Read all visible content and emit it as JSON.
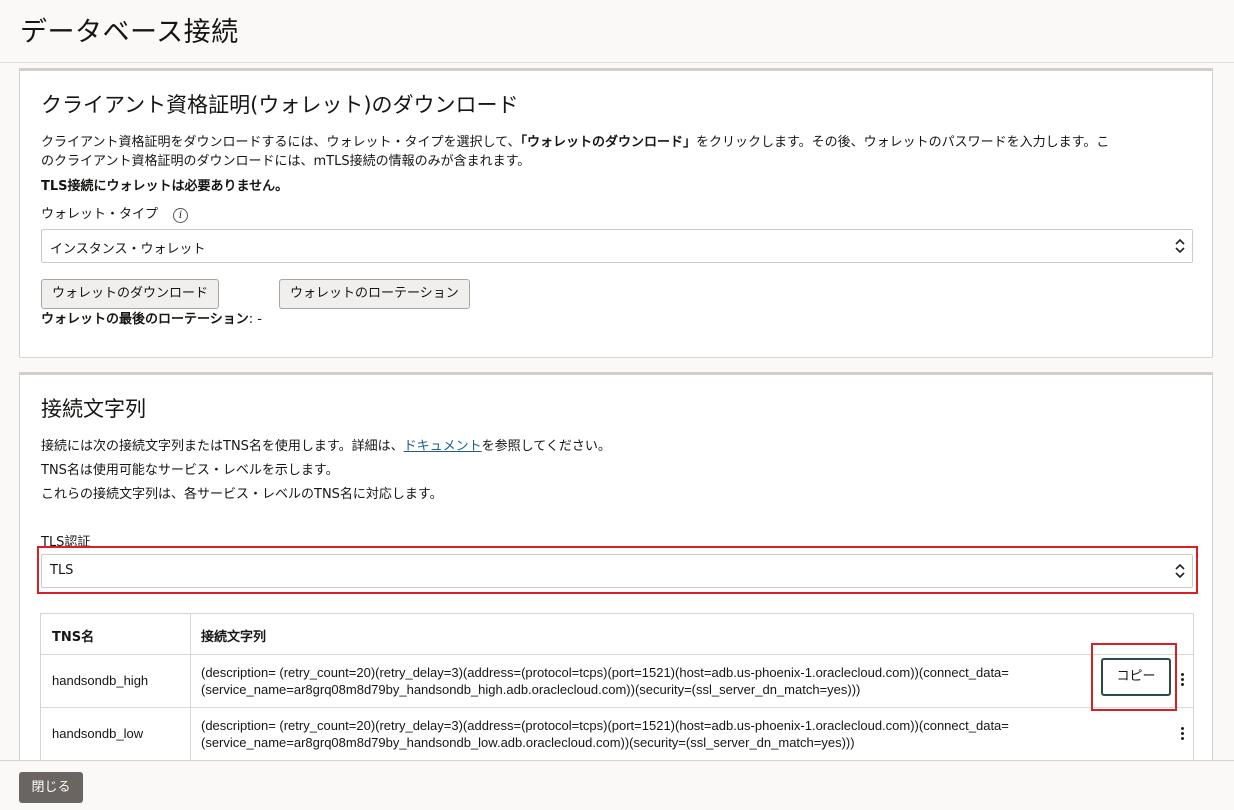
{
  "page_title": "データベース接続",
  "wallet_section": {
    "title": "クライアント資格証明(ウォレット)のダウンロード",
    "desc_part1": "クライアント資格証明をダウンロードするには、ウォレット・タイプを選択して、",
    "desc_bold": "「ウォレットのダウンロード」",
    "desc_part2": "をクリックします。その後、ウォレットのパスワードを入力します。こ",
    "desc_line2": "のクライアント資格証明のダウンロードには、mTLS接続の情報のみが含まれます。",
    "tls_note": "TLS接続にウォレットは必要ありません。",
    "wallet_type_label": "ウォレット・タイプ",
    "wallet_type_value": "インスタンス・ウォレット",
    "download_button": "ウォレットのダウンロード",
    "rotate_button": "ウォレットのローテーション",
    "last_rotation_label": "ウォレットの最後のローテーション",
    "last_rotation_value": ": -"
  },
  "conn_section": {
    "title": "接続文字列",
    "desc_line1_pre": "接続には次の接続文字列またはTNS名を使用します。詳細は、",
    "desc_link": "ドキュメント",
    "desc_line1_post": "を参照してください。",
    "desc_line2": "TNS名は使用可能なサービス・レベルを示します。",
    "desc_line3": "これらの接続文字列は、各サービス・レベルのTNS名に対応します。",
    "tls_label": "TLS認証",
    "tls_value": "TLS",
    "table": {
      "col_tns": "TNS名",
      "col_conn": "接続文字列",
      "rows": [
        {
          "tns": "handsondb_high",
          "conn_line1": "(description= (retry_count=20)(retry_delay=3)(address=(protocol=tcps)(port=1521)(host=adb.us-phoenix-1.oraclecloud.com))(connect_data=",
          "conn_line2": "(service_name=ar8grq08m8d79by_handsondb_high.adb.oraclecloud.com))(security=(ssl_server_dn_match=yes)))"
        },
        {
          "tns": "handsondb_low",
          "conn_line1": "(description= (retry_count=20)(retry_delay=3)(address=(protocol=tcps)(port=1521)(host=adb.us-phoenix-1.oraclecloud.com))(connect_data=",
          "conn_line2": "(service_name=ar8grq08m8d79by_handsondb_low.adb.oraclecloud.com))(security=(ssl_server_dn_match=yes)))"
        }
      ],
      "copy_button": "コピー"
    }
  },
  "footer": {
    "close_button": "閉じる"
  }
}
